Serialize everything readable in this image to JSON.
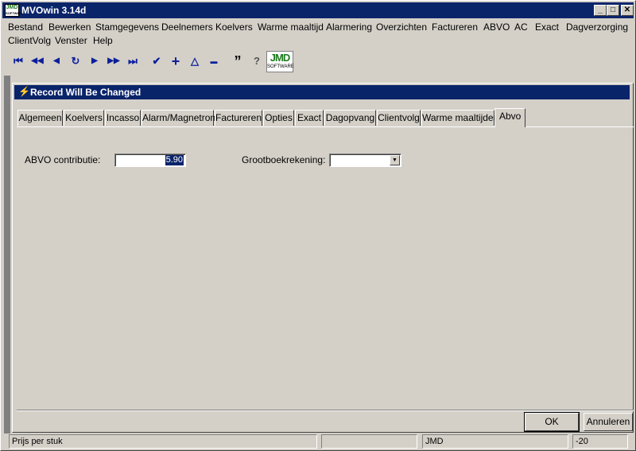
{
  "window": {
    "title": "MVOwin 3.14d",
    "logo_top": "JMD",
    "logo_bottom": "SOFTWARE",
    "min_glyph": "_",
    "max_glyph": "□",
    "close_glyph": "✕"
  },
  "menu": {
    "row1": [
      "Bestand",
      "Bewerken",
      "Stamgegevens",
      "Deelnemers",
      "Koelvers",
      "Warme maaltijd",
      "Alarmering",
      "Overzichten",
      "Factureren",
      "ABVO",
      "AC",
      "Exact",
      "Dagverzorging"
    ],
    "row2": [
      "ClientVolg",
      "Venster",
      "Help"
    ]
  },
  "toolbar": {
    "icons": [
      {
        "name": "first-record-icon",
        "glyph": "⏮"
      },
      {
        "name": "prior-page-icon",
        "glyph": "◀◀"
      },
      {
        "name": "prior-record-icon",
        "glyph": "◀"
      },
      {
        "name": "refresh-icon",
        "glyph": "↻"
      },
      {
        "name": "next-record-icon",
        "glyph": "▶"
      },
      {
        "name": "next-page-icon",
        "glyph": "▶▶"
      },
      {
        "name": "last-record-icon",
        "glyph": "⏭"
      },
      {
        "name": "post-check-icon",
        "glyph": "✔"
      },
      {
        "name": "insert-plus-icon",
        "glyph": "+"
      },
      {
        "name": "edit-triangle-icon",
        "glyph": "△"
      },
      {
        "name": "delete-dash-icon",
        "glyph": "▬"
      },
      {
        "name": "quote-icon",
        "glyph": "”"
      },
      {
        "name": "help-question-icon",
        "glyph": "?"
      }
    ],
    "jmd_big": "JMD",
    "jmd_small": "SOFTWARE"
  },
  "child": {
    "title": "Record Will Be Changed",
    "bolt": "⚡"
  },
  "tabs": [
    "Algemeen",
    "Koelvers",
    "Incasso",
    "Alarm/Magnetron",
    "Factureren",
    "Opties",
    "Exact",
    "Dagopvang",
    "Clientvolg",
    "Warme maaltijden",
    "Abvo"
  ],
  "active_tab": "Abvo",
  "form": {
    "contributie_label": "ABVO contributie:",
    "contributie_value": "5.90",
    "grootboek_label": "Grootboekrekening:",
    "grootboek_value": "",
    "dropdown_glyph": "▼"
  },
  "buttons": {
    "ok": "OK",
    "cancel": "Annuleren"
  },
  "status": {
    "hint": "Prijs per stuk",
    "field2": "",
    "user": "JMD",
    "code": "-20"
  },
  "colors": {
    "titlebar": "#0a246a",
    "face": "#d4d0c8",
    "accent_green": "#1b7a1b",
    "icon_blue": "#0c1f9a"
  }
}
